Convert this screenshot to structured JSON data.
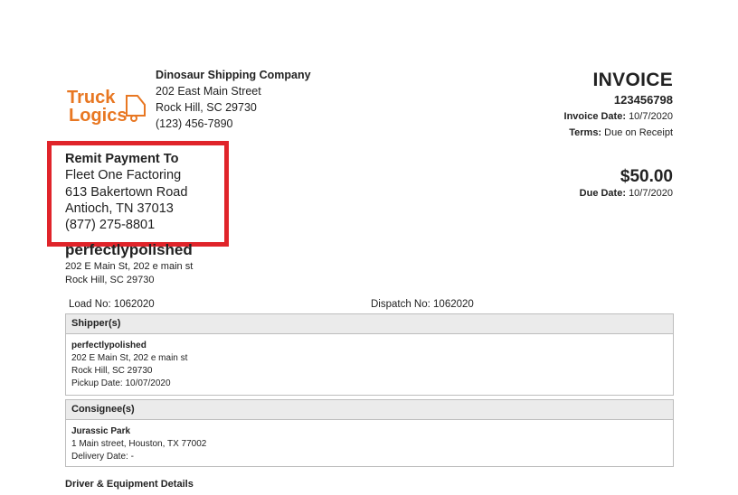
{
  "logo": {
    "line1": "Truck",
    "line2": "Logics",
    "color": "#e87722"
  },
  "company": {
    "name": "Dinosaur Shipping Company",
    "address1": "202 East Main Street",
    "address2": "Rock Hill, SC 29730",
    "phone": "(123) 456-7890"
  },
  "invoice": {
    "title": "INVOICE",
    "number": "123456798",
    "date_label": "Invoice Date:",
    "date": "10/7/2020",
    "terms_label": "Terms:",
    "terms": "Due on Receipt",
    "amount": "$50.00",
    "due_label": "Due Date:",
    "due_date": "10/7/2020"
  },
  "remit": {
    "heading": "Remit Payment To",
    "name": "Fleet One Factoring",
    "address1": "613 Bakertown Road",
    "address2": "Antioch, TN 37013",
    "phone": "(877) 275-8801",
    "highlight_color": "#e0242a"
  },
  "customer": {
    "name": "perfectlypolished",
    "address1": "202 E Main St, 202 e main st",
    "address2": "Rock Hill, SC 29730"
  },
  "load": {
    "load_text": "Load No: 1062020",
    "dispatch_text": "Dispatch No: 1062020"
  },
  "shipper": {
    "heading": "Shipper(s)",
    "name": "perfectlypolished",
    "address1": "202 E Main St, 202 e main st",
    "address2": "Rock Hill, SC 29730",
    "pickup": "Pickup Date: 10/07/2020"
  },
  "consignee": {
    "heading": "Consignee(s)",
    "name": "Jurassic Park",
    "address1": "1 Main street, Houston, TX 77002",
    "delivery": "Delivery Date: -"
  },
  "driver_section": {
    "heading": "Driver & Equipment Details"
  }
}
